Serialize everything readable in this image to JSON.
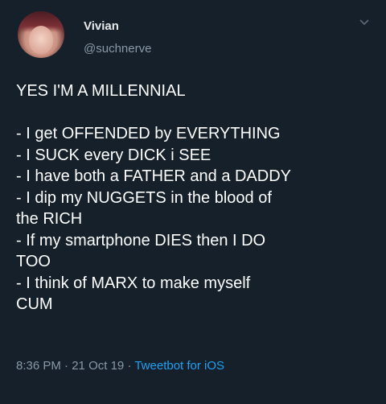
{
  "user": {
    "display_name": "Vivian",
    "handle": "@suchnerve"
  },
  "tweet": {
    "heading": "YES I'M A MILLENNIAL",
    "lines": [
      "- I get OFFENDED by EVERYTHING",
      "- I SUCK every DICK i SEE",
      "- I have both a FATHER and a DADDY",
      "- I dip my NUGGETS in the blood of",
      "the RICH",
      "- If my smartphone DIES then I DO",
      "TOO",
      "- I think of MARX to make myself",
      "CUM"
    ]
  },
  "meta": {
    "time": "8:36 PM",
    "separator": "·",
    "date": "21 Oct 19",
    "source": "Tweetbot for iOS"
  },
  "icons": {
    "avatar": "profile-photo",
    "menu": "chevron-down-icon"
  },
  "colors": {
    "background": "#15202b",
    "text": "#ffffff",
    "secondary": "#8899a6",
    "link": "#1da1f2"
  }
}
